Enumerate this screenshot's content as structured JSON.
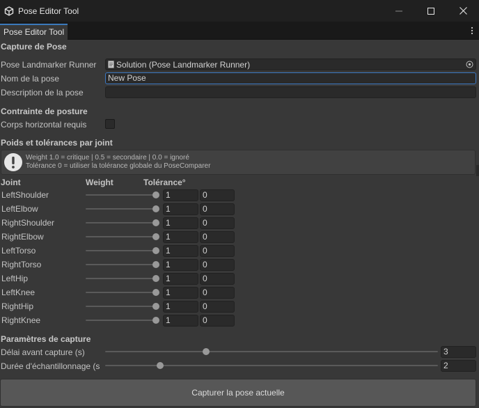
{
  "window": {
    "title": "Pose Editor Tool",
    "icons": {
      "app": "unity-logo-icon",
      "minimize": "minimize-icon",
      "maximize": "maximize-icon",
      "close": "close-icon"
    }
  },
  "tab": {
    "label": "Pose Editor Tool",
    "menu_icon": "kebab-menu-icon"
  },
  "capture": {
    "header": "Capture de Pose",
    "runner_label": "Pose Landmarker Runner",
    "runner_value": "Solution (Pose Landmarker Runner)",
    "name_label": "Nom de la pose",
    "name_value": "New Pose",
    "description_label": "Description de la pose",
    "description_value": ""
  },
  "posture": {
    "header": "Contrainte de posture",
    "horizontal_label": "Corps horizontal requis",
    "horizontal_checked": false
  },
  "weights": {
    "header": "Poids et tolérances par joint",
    "help_line1": "Weight 1.0 = critique | 0.5 = secondaire | 0.0 = ignoré",
    "help_line2": "Tolérance 0 = utiliser la tolérance globale du PoseComparer",
    "col_joint": "Joint",
    "col_weight": "Weight",
    "col_tolerance": "Tolérance°",
    "joints": [
      {
        "name": "LeftShoulder",
        "weight": "1",
        "tolerance": "0"
      },
      {
        "name": "LeftElbow",
        "weight": "1",
        "tolerance": "0"
      },
      {
        "name": "RightShoulder",
        "weight": "1",
        "tolerance": "0"
      },
      {
        "name": "RightElbow",
        "weight": "1",
        "tolerance": "0"
      },
      {
        "name": "LeftTorso",
        "weight": "1",
        "tolerance": "0"
      },
      {
        "name": "RightTorso",
        "weight": "1",
        "tolerance": "0"
      },
      {
        "name": "LeftHip",
        "weight": "1",
        "tolerance": "0"
      },
      {
        "name": "LeftKnee",
        "weight": "1",
        "tolerance": "0"
      },
      {
        "name": "RightHip",
        "weight": "1",
        "tolerance": "0"
      },
      {
        "name": "RightKnee",
        "weight": "1",
        "tolerance": "0"
      }
    ]
  },
  "params": {
    "header": "Paramètres de capture",
    "delay_label": "Délai avant capture (s)",
    "delay_value": "3",
    "duration_label": "Durée d'échantillonnage (s",
    "duration_value": "2"
  },
  "capture_button": "Capturer la pose actuelle"
}
